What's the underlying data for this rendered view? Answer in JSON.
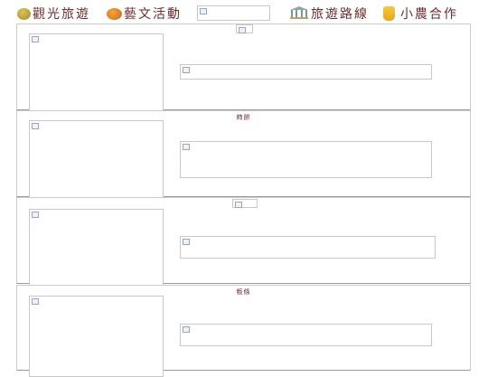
{
  "nav": {
    "items": [
      {
        "label": "觀光旅遊",
        "icon": "fruit-icon"
      },
      {
        "label": "藝文活動",
        "icon": "persimmon-icon"
      },
      {
        "label": "旅遊路線",
        "icon": "pavilion-icon"
      },
      {
        "label": "小農合作",
        "icon": "honey-jar-icon"
      }
    ]
  },
  "panels": [
    {
      "title": ""
    },
    {
      "title": "柿餅"
    },
    {
      "title": ""
    },
    {
      "title": "粄條"
    }
  ]
}
